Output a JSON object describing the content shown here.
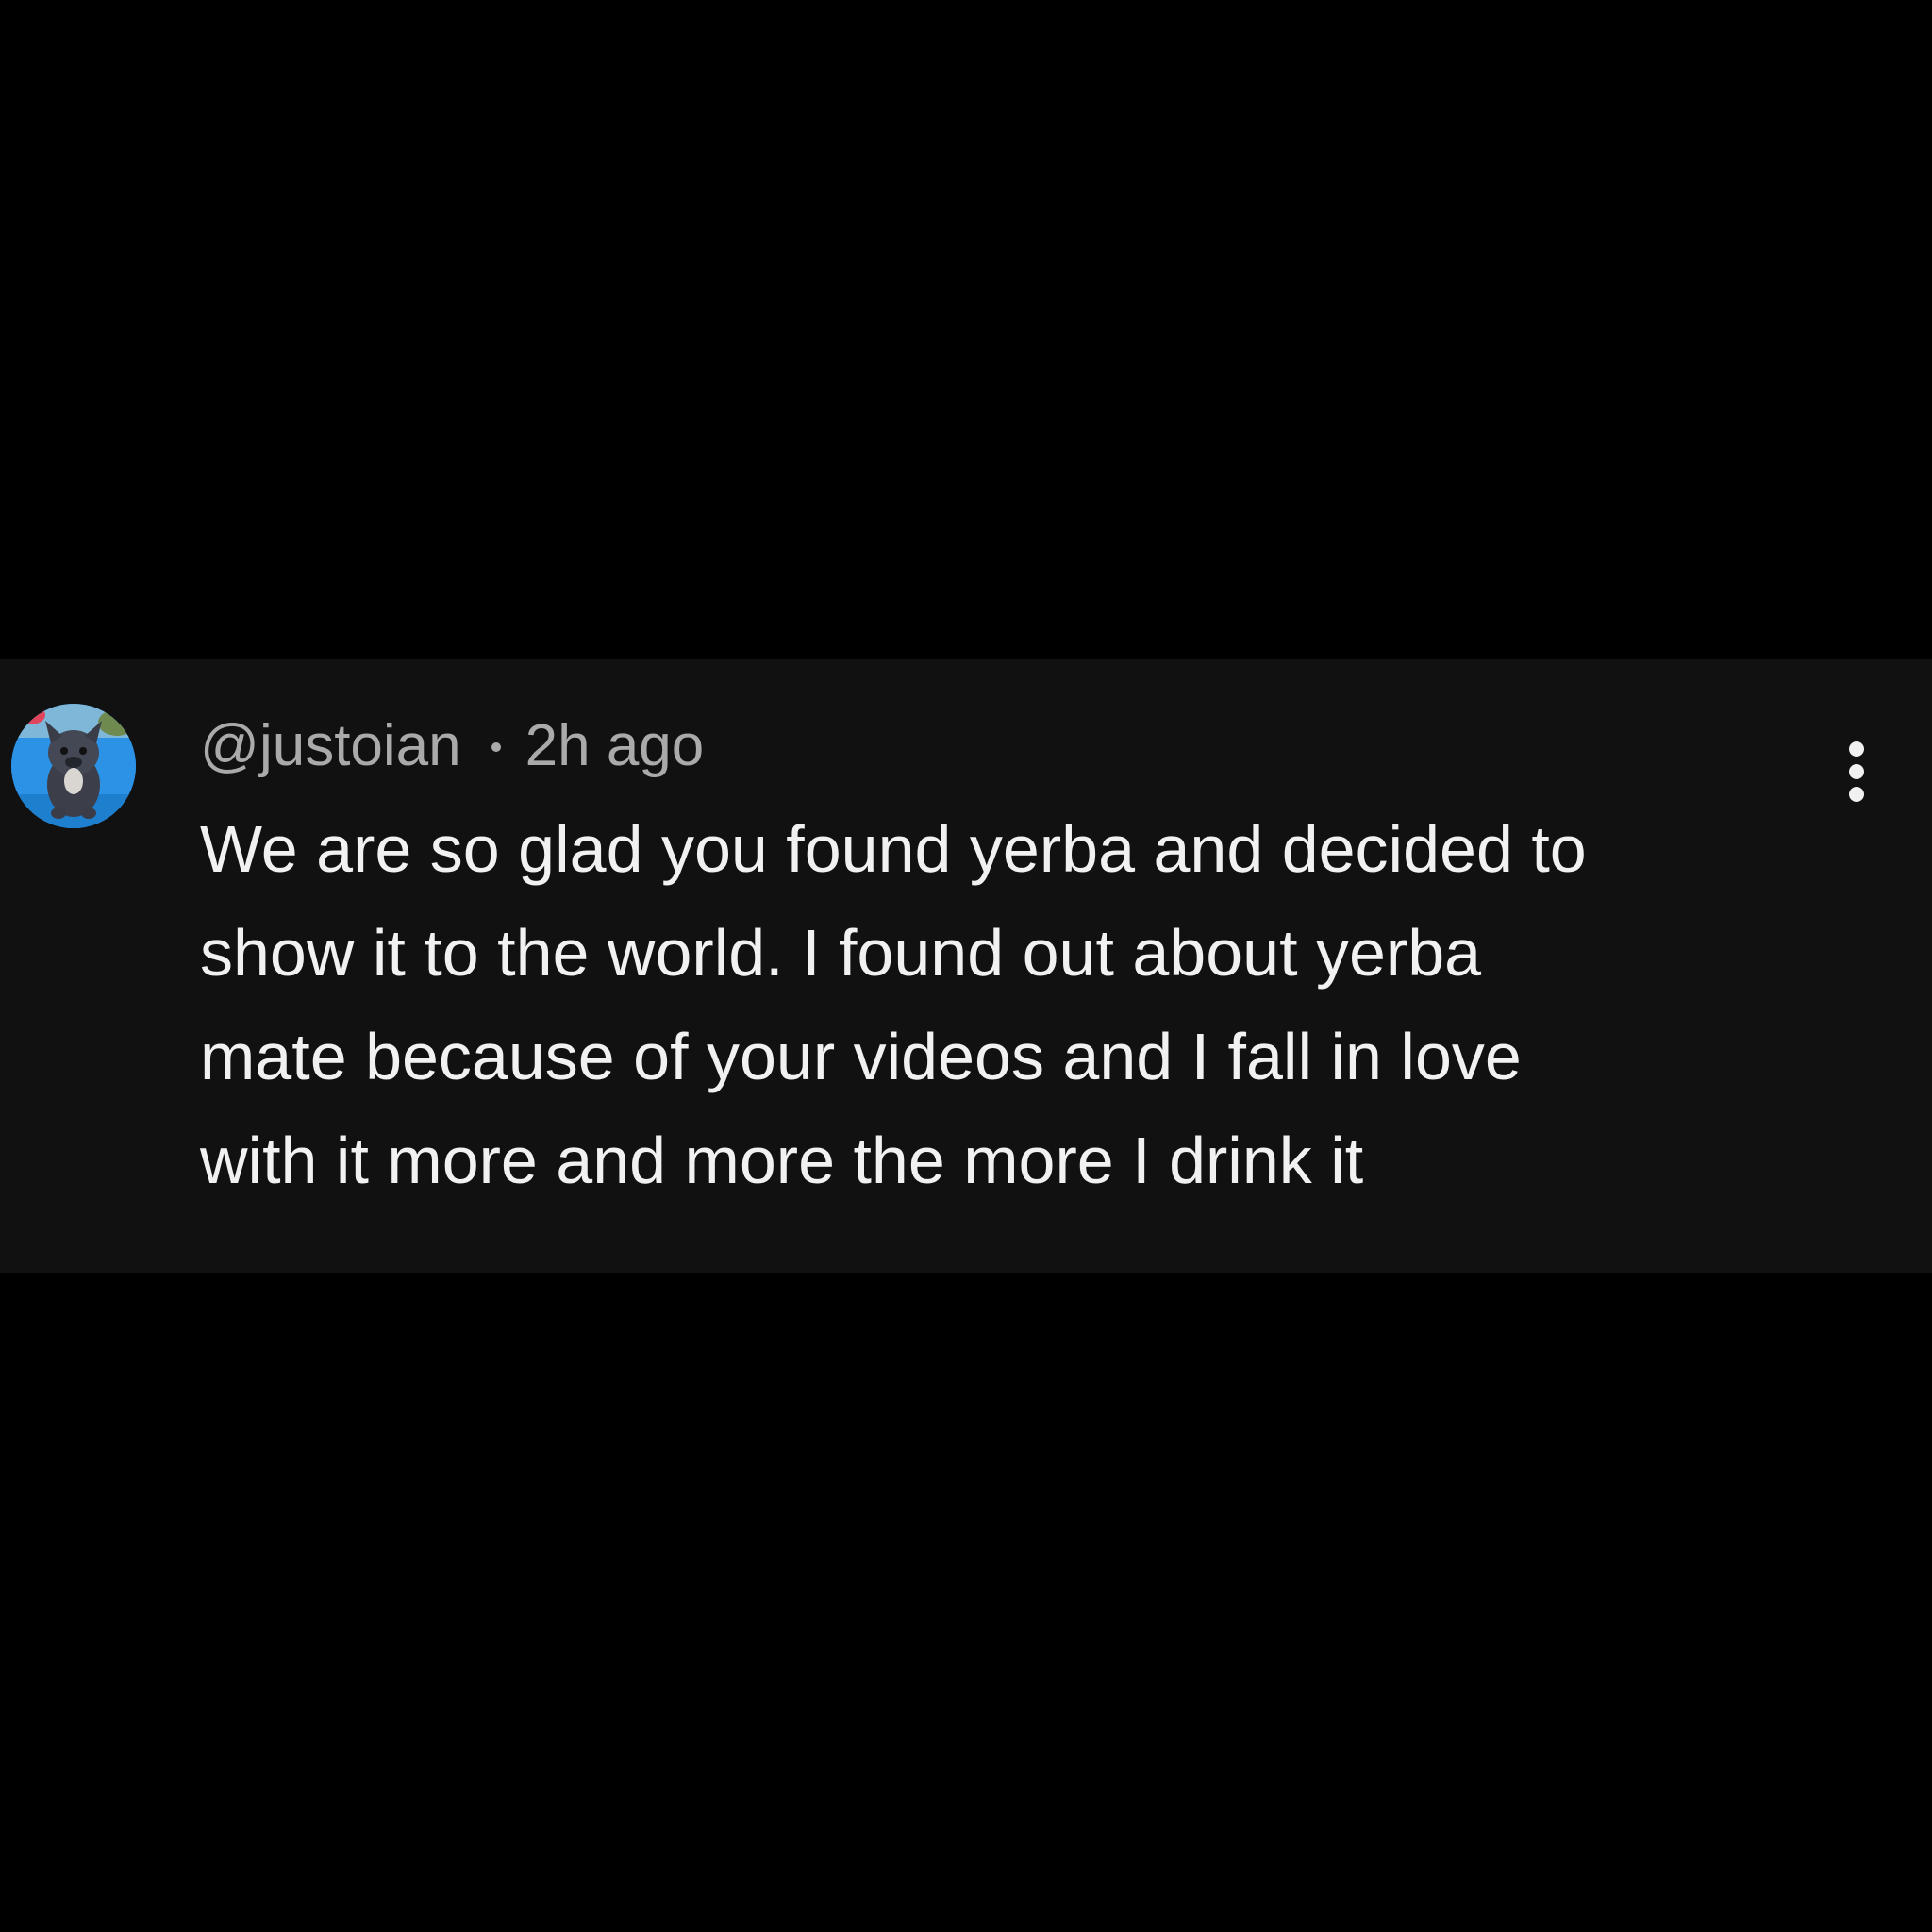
{
  "comment": {
    "author_handle": "@justoian",
    "timestamp": "2h ago",
    "body_lines": [
      "We are so glad you found yerba and decided to",
      "show it to the world. I found out about yerba",
      "mate because of your videos and I fall in love",
      "with it more and more the more I drink it"
    ],
    "avatar_icon": "french-bulldog-avatar",
    "more_icon": "more-vertical-icon"
  },
  "colors": {
    "page_background": "#000000",
    "card_background": "#111111",
    "meta_text": "#aaaaaa",
    "body_text": "#f1f1f1"
  }
}
